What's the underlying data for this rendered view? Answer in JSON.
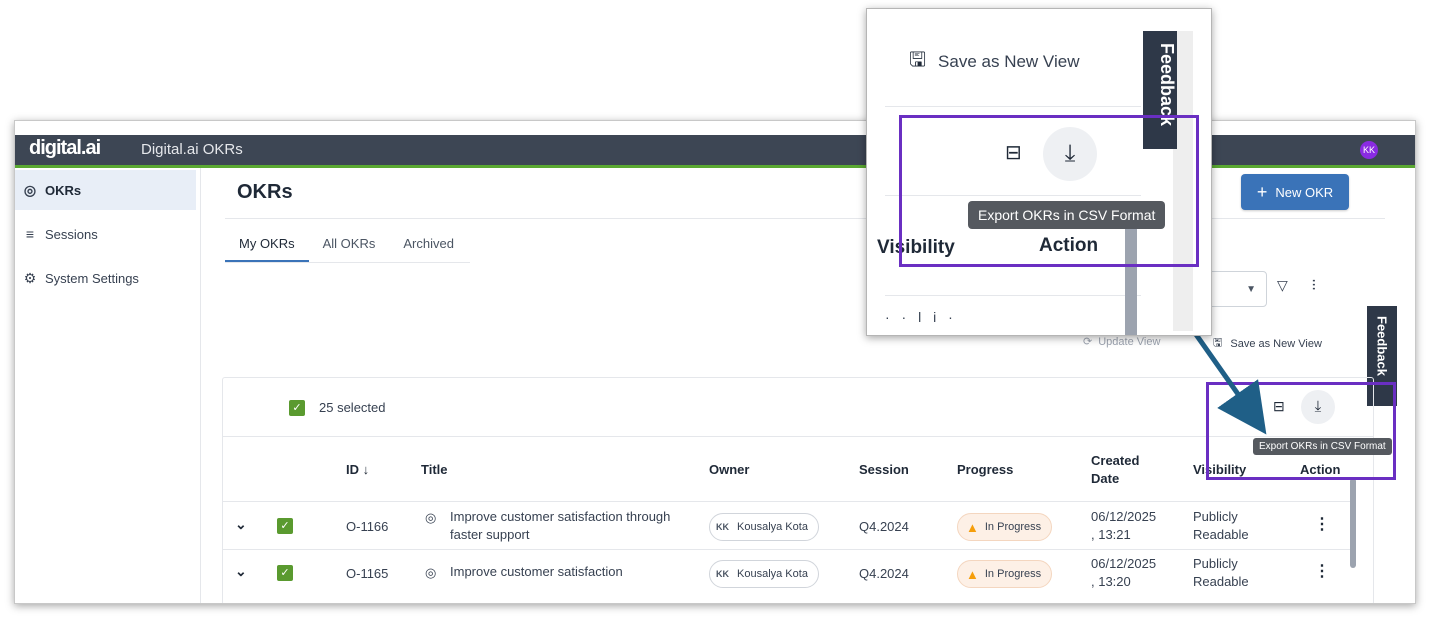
{
  "header": {
    "brand": "digital.ai",
    "product": "Digital.ai OKRs",
    "avatar": "KK"
  },
  "sidebar": {
    "items": [
      {
        "label": "OKRs",
        "icon": "target-icon",
        "active": true
      },
      {
        "label": "Sessions",
        "icon": "list-icon",
        "active": false
      },
      {
        "label": "System Settings",
        "icon": "gear-icon",
        "active": false
      }
    ]
  },
  "page": {
    "title": "OKRs",
    "new_button": "New OKR"
  },
  "tabs": [
    {
      "label": "My OKRs",
      "active": true
    },
    {
      "label": "All OKRs"
    },
    {
      "label": "Archived"
    }
  ],
  "toolbar": {
    "update_view": "Update View",
    "save_view": "Save as New View"
  },
  "feedback": "Feedback",
  "selection": {
    "label": "25 selected",
    "export_tooltip": "Export OKRs in CSV Format"
  },
  "table": {
    "headers": {
      "id": "ID ↓",
      "title": "Title",
      "owner": "Owner",
      "session": "Session",
      "progress": "Progress",
      "created_line1": "Created",
      "created_line2": "Date",
      "visibility": "Visibility",
      "action": "Action"
    },
    "rows": [
      {
        "id": "O-1166",
        "title_line1": "Improve customer satisfaction through",
        "title_line2": "faster support",
        "owner_initials": "KK",
        "owner": "Kousalya Kota",
        "session": "Q4.2024",
        "progress": "In Progress",
        "created_line1": "06/12/2025",
        "created_line2": ", 13:21",
        "visibility_line1": "Publicly",
        "visibility_line2": "Readable"
      },
      {
        "id": "O-1165",
        "title_line1": "Improve customer satisfaction",
        "title_line2": "",
        "owner_initials": "KK",
        "owner": "Kousalya Kota",
        "session": "Q4.2024",
        "progress": "In Progress",
        "created_line1": "06/12/2025",
        "created_line2": ", 13:20",
        "visibility_line1": "Publicly",
        "visibility_line2": "Readable"
      }
    ]
  },
  "zoom": {
    "save_view": "Save as New View",
    "tooltip": "Export OKRs in CSV Format",
    "visibility": "Visibility",
    "action": "Action",
    "feedback": "Feedback"
  },
  "colors": {
    "topbar": "#3d4654",
    "accent": "#3a73b8",
    "highlight": "#6a2fc2",
    "arrow": "#1f5f87",
    "checkbox": "#5a9a2f"
  }
}
